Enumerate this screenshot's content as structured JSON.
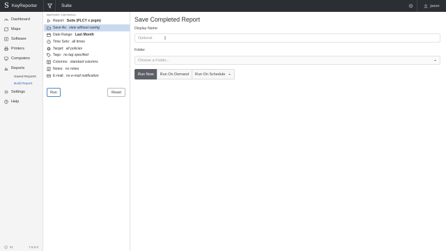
{
  "topbar": {
    "brand_mark": "S",
    "brand_name": "KeyReporter",
    "context": "Suite",
    "user": "jason",
    "icons": [
      "filter-icon",
      "gear-icon",
      "user-icon"
    ]
  },
  "nav": {
    "items": [
      {
        "label": "Dashboard",
        "icon": "dashboard-icon"
      },
      {
        "label": "Maps",
        "icon": "map-icon"
      },
      {
        "label": "Software",
        "icon": "software-icon"
      },
      {
        "label": "Printers",
        "icon": "printer-icon"
      },
      {
        "label": "Computers",
        "icon": "computer-icon"
      },
      {
        "label": "Reports",
        "icon": "reports-icon"
      },
      {
        "label": "Settings",
        "icon": "gear-icon"
      },
      {
        "label": "Help",
        "icon": "help-icon"
      }
    ],
    "sub_items": [
      {
        "label": "Saved Reports"
      },
      {
        "label": "Build Report",
        "active": true
      }
    ],
    "footer_icon_label": "#1",
    "version": "7.6.0.0"
  },
  "criteria": {
    "header": "REPORT CRITERIA",
    "rows": [
      {
        "prefix": "Report:",
        "value": "Suite (PLCY x prgm)",
        "style": "bold",
        "icon": "play-icon"
      },
      {
        "prefix": "Save As:",
        "value": "view without saving",
        "style": "italic",
        "icon": "folder-icon",
        "selected": true
      },
      {
        "prefix": "Date Range:",
        "value": "Last Month",
        "style": "bold",
        "icon": "calendar-icon"
      },
      {
        "prefix": "Time Sets:",
        "value": "all times",
        "style": "plain",
        "icon": "clock-icon"
      },
      {
        "prefix": "Target:",
        "value": "all policies",
        "style": "italic",
        "icon": "target-icon"
      },
      {
        "prefix": "Tags:",
        "value": "no tag specified",
        "style": "italic",
        "icon": "tag-icon"
      },
      {
        "prefix": "Columns:",
        "value": "standard columns",
        "style": "italic",
        "icon": "columns-icon"
      },
      {
        "prefix": "Notes:",
        "value": "no notes",
        "style": "plain",
        "icon": "notes-icon"
      },
      {
        "prefix": "E-mail:",
        "value": "no e-mail notification",
        "style": "italic",
        "icon": "email-icon"
      }
    ],
    "run_label": "Run",
    "reset_label": "Reset"
  },
  "main": {
    "title": "Save Completed Report",
    "display_name_label": "Display Name",
    "display_name_placeholder": "Optional",
    "folder_label": "Folder",
    "folder_placeholder": "Choose a Folder...",
    "buttons": {
      "run_now": "Run Now",
      "run_on_demand": "Run On Demand",
      "run_on_schedule": "Run On Schedule"
    }
  }
}
